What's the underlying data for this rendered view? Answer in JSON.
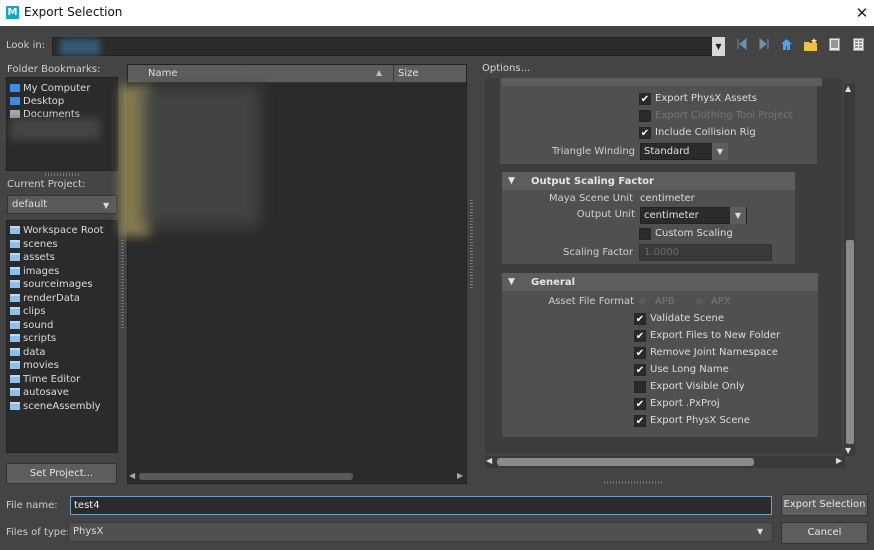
{
  "window": {
    "title": "Export Selection",
    "app_icon": "M",
    "close_glyph": "✕"
  },
  "look_in": {
    "label": "Look in:"
  },
  "bookmarks": {
    "label": "Folder Bookmarks:",
    "items": [
      "My Computer",
      "Desktop",
      "Documents"
    ]
  },
  "project": {
    "label": "Current Project:",
    "value": "default",
    "folders": [
      "Workspace Root",
      "scenes",
      "assets",
      "images",
      "sourceimages",
      "renderData",
      "clips",
      "sound",
      "scripts",
      "data",
      "movies",
      "Time Editor",
      "autosave",
      "sceneAssembly"
    ],
    "set_button": "Set Project..."
  },
  "file_list": {
    "col_name": "Name",
    "col_size": "Size"
  },
  "options": {
    "label": "Options...",
    "top_checks": [
      {
        "label": "Export PhysX Assets",
        "checked": true,
        "disabled": false
      },
      {
        "label": "Export Clothing Tool Project",
        "checked": false,
        "disabled": true
      },
      {
        "label": "Include Collision Rig",
        "checked": true,
        "disabled": false
      }
    ],
    "triangle_winding": {
      "label": "Triangle Winding",
      "value": "Standard"
    },
    "output_scaling": {
      "title": "Output Scaling Factor",
      "scene_unit_label": "Maya Scene Unit",
      "scene_unit_value": "centimeter",
      "output_unit_label": "Output Unit",
      "output_unit_value": "centimeter",
      "custom_scaling_label": "Custom Scaling",
      "scaling_factor_label": "Scaling Factor",
      "scaling_factor_value": "1.0000"
    },
    "general": {
      "title": "General",
      "asset_format_label": "Asset File Format",
      "format_options": [
        "APB",
        "APX"
      ],
      "checks": [
        {
          "label": "Validate Scene",
          "checked": true
        },
        {
          "label": "Export Files to New Folder",
          "checked": true
        },
        {
          "label": "Remove Joint Namespace",
          "checked": true
        },
        {
          "label": "Use Long Name",
          "checked": true
        },
        {
          "label": "Export Visible Only",
          "checked": false
        },
        {
          "label": "Export .PxProj",
          "checked": true
        },
        {
          "label": "Export PhysX Scene",
          "checked": true
        }
      ]
    }
  },
  "bottom": {
    "file_name_label": "File name:",
    "file_name_value": "test4",
    "export_button": "Export Selection",
    "file_type_label": "Files of type:",
    "file_type_value": "PhysX",
    "cancel_button": "Cancel"
  },
  "colors": {
    "accent": "#6f9fc9",
    "folder": "#8ec0ef",
    "panel": "#2b2b2b",
    "background": "#444444"
  }
}
